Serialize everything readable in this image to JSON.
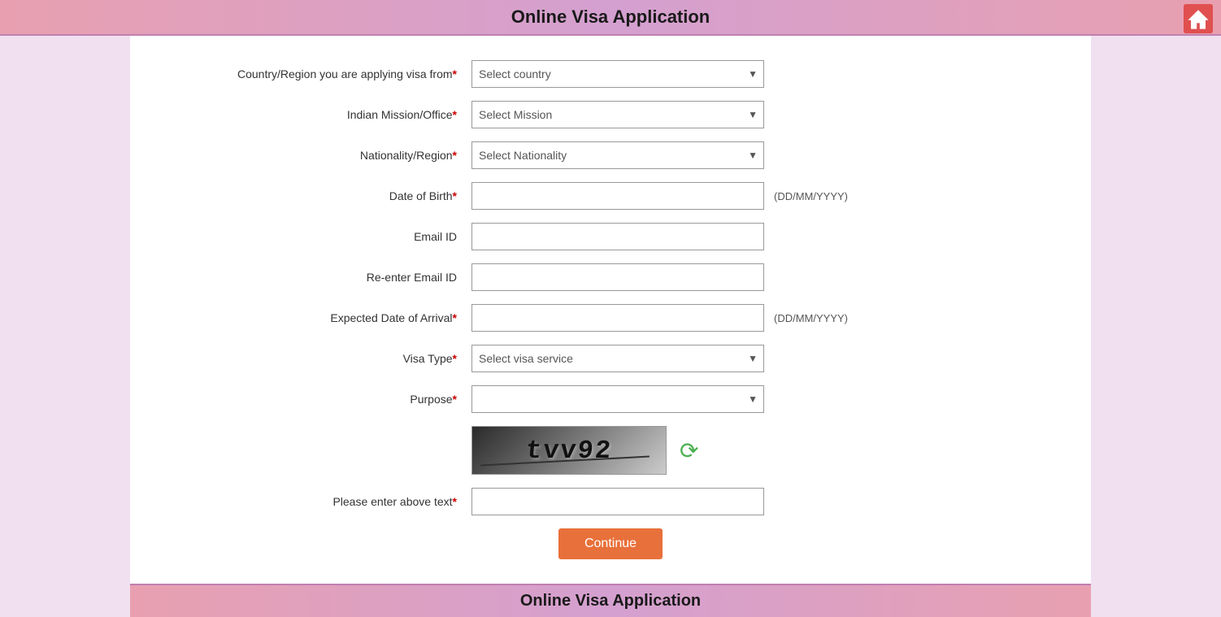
{
  "header": {
    "title": "Online Visa Application"
  },
  "footer": {
    "title": "Online Visa Application"
  },
  "form": {
    "fields": [
      {
        "id": "country",
        "label": "Country/Region you are applying visa from",
        "required": true,
        "type": "select",
        "placeholder": "Select country"
      },
      {
        "id": "mission",
        "label": "Indian Mission/Office",
        "required": true,
        "type": "select",
        "placeholder": "Select Mission"
      },
      {
        "id": "nationality",
        "label": "Nationality/Region",
        "required": true,
        "type": "select",
        "placeholder": "Select Nationality"
      },
      {
        "id": "dob",
        "label": "Date of Birth",
        "required": true,
        "type": "text",
        "hint": "(DD/MM/YYYY)"
      },
      {
        "id": "email",
        "label": "Email ID",
        "required": false,
        "type": "text"
      },
      {
        "id": "reenter_email",
        "label": "Re-enter Email ID",
        "required": false,
        "type": "text"
      },
      {
        "id": "arrival_date",
        "label": "Expected Date of Arrival",
        "required": true,
        "type": "text",
        "hint": "(DD/MM/YYYY)"
      },
      {
        "id": "visa_type",
        "label": "Visa Type",
        "required": true,
        "type": "select",
        "placeholder": "Select visa service"
      },
      {
        "id": "purpose",
        "label": "Purpose",
        "required": true,
        "type": "select",
        "placeholder": ""
      }
    ],
    "captcha_text": "tvv92",
    "captcha_label": "",
    "captcha_input_label": "Please enter above text",
    "captcha_required": true,
    "continue_button": "Continue"
  }
}
